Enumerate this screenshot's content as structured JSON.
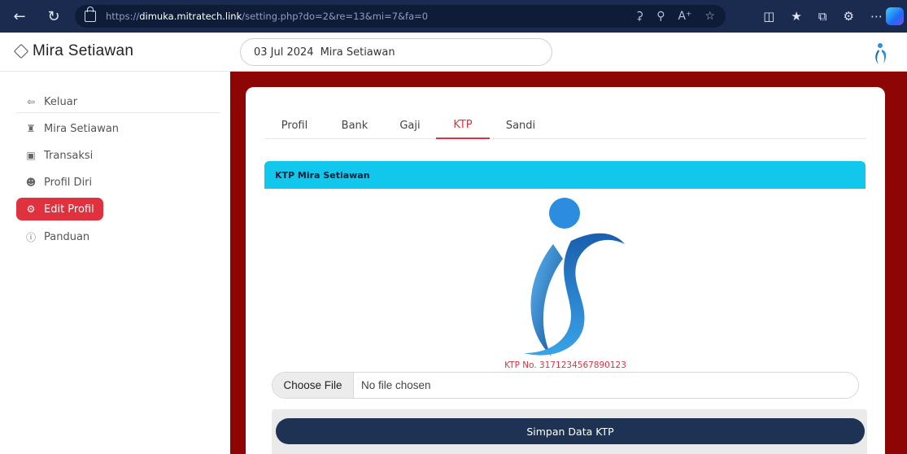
{
  "browser": {
    "url_prefix": "https://",
    "url_host": "dimuka.mitratech.link",
    "url_path": "/setting.php?do=2&re=13&mi=7&fa=0"
  },
  "header": {
    "brand": "Mira Setiawan",
    "date": "03 Jul 2024",
    "user": "Mira Setiawan"
  },
  "sidebar": {
    "items": [
      {
        "label": "Keluar",
        "icon": "logout-icon"
      },
      {
        "label": "Mira Setiawan",
        "icon": "user-solid-icon"
      },
      {
        "label": "Transaksi",
        "icon": "card-icon"
      },
      {
        "label": "Profil Diri",
        "icon": "person-icon"
      },
      {
        "label": "Edit Profil",
        "icon": "gear-icon",
        "active": true
      },
      {
        "label": "Panduan",
        "icon": "help-icon"
      }
    ]
  },
  "tabs": [
    "Profil",
    "Bank",
    "Gaji",
    "KTP",
    "Sandi"
  ],
  "active_tab": "KTP",
  "panel": {
    "title": "KTP Mira Setiawan",
    "ktp_number": "KTP No. 3171234567890123"
  },
  "file": {
    "button": "Choose File",
    "status": "No file chosen"
  },
  "save_label": "Simpan Data KTP",
  "colors": {
    "accent_red": "#e0313f",
    "maroon": "#8e0505",
    "cyan_header": "#12c7ec",
    "navy_button": "#1e3253"
  }
}
